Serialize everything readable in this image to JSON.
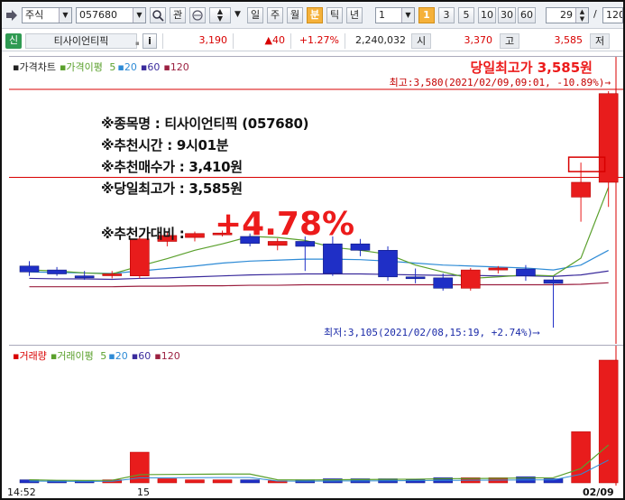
{
  "toolbar": {
    "market": "주식",
    "code": "057680",
    "btn_gwan": "관",
    "period_ticks": [
      "일",
      "주",
      "월",
      "분",
      "틱",
      "년"
    ],
    "active_period": "분",
    "interval_value": "1",
    "interval_buttons": [
      "1",
      "3",
      "5",
      "10",
      "30",
      "60"
    ],
    "active_interval": "1",
    "count_value": "29",
    "slash": "/",
    "total_value": "120"
  },
  "quote": {
    "tag": "신",
    "name": "티사이언티픽",
    "info_btn": "i",
    "price": "3,190",
    "change": "▲40",
    "rate": "+1.27%",
    "volume": "2,240,032",
    "open_label": "시",
    "open_value": "3,370",
    "high_label": "고",
    "high_value": "3,585",
    "low_label": "저"
  },
  "price_legend": {
    "main": "가격차트",
    "ma_title": "가격이평",
    "ma": [
      "5",
      "20",
      "60",
      "120"
    ]
  },
  "volume_legend": {
    "main": "거래량",
    "ma_title": "거래이평",
    "ma": [
      "5",
      "20",
      "60",
      "120"
    ]
  },
  "notes": {
    "line1": "※종목명 : 티사이언티픽 (057680)",
    "line2": "※추천시간 : 9시01분",
    "line3": "※추천매수가 : 3,410원",
    "line4": "※당일최고가 : 3,585원",
    "line5_label": "※추천가대비 :",
    "line5_value": "+4.78%"
  },
  "max_annotation": {
    "headline": "당일최고가 3,585원",
    "sub": "최고:3,580(2021/02/09,09:01, -10.89%)→"
  },
  "min_annotation": "최저:3,105(2021/02/08,15:19, +2.74%)⟶",
  "xaxis": [
    "14:52",
    "15",
    "02/09"
  ],
  "colors": {
    "up": "#e81c1c",
    "down": "#1f2fc6",
    "ma5": "#5aa02c",
    "ma20": "#2e8bd6",
    "ma60": "#3a2b9c",
    "ma120": "#9b2040"
  },
  "chart_data": {
    "type": "candlestick",
    "candles": [
      {
        "o": 3230,
        "h": 3240,
        "l": 3210,
        "c": 3218
      },
      {
        "o": 3222,
        "h": 3228,
        "l": 3210,
        "c": 3214
      },
      {
        "o": 3210,
        "h": 3220,
        "l": 3202,
        "c": 3206
      },
      {
        "o": 3212,
        "h": 3220,
        "l": 3205,
        "c": 3214
      },
      {
        "o": 3210,
        "h": 3290,
        "l": 3205,
        "c": 3285
      },
      {
        "o": 3280,
        "h": 3300,
        "l": 3270,
        "c": 3292
      },
      {
        "o": 3288,
        "h": 3300,
        "l": 3280,
        "c": 3296
      },
      {
        "o": 3296,
        "h": 3302,
        "l": 3290,
        "c": 3297
      },
      {
        "o": 3290,
        "h": 3296,
        "l": 3270,
        "c": 3276
      },
      {
        "o": 3272,
        "h": 3286,
        "l": 3262,
        "c": 3280
      },
      {
        "o": 3280,
        "h": 3290,
        "l": 3220,
        "c": 3270
      },
      {
        "o": 3275,
        "h": 3290,
        "l": 3210,
        "c": 3215
      },
      {
        "o": 3275,
        "h": 3285,
        "l": 3250,
        "c": 3262
      },
      {
        "o": 3262,
        "h": 3270,
        "l": 3200,
        "c": 3208
      },
      {
        "o": 3208,
        "h": 3225,
        "l": 3195,
        "c": 3206
      },
      {
        "o": 3206,
        "h": 3215,
        "l": 3180,
        "c": 3185
      },
      {
        "o": 3185,
        "h": 3226,
        "l": 3180,
        "c": 3222
      },
      {
        "o": 3222,
        "h": 3230,
        "l": 3215,
        "c": 3226
      },
      {
        "o": 3224,
        "h": 3232,
        "l": 3200,
        "c": 3210
      },
      {
        "o": 3202,
        "h": 3208,
        "l": 3105,
        "c": 3195
      },
      {
        "o": 3370,
        "h": 3440,
        "l": 3320,
        "c": 3400
      },
      {
        "o": 3400,
        "h": 3585,
        "l": 3350,
        "c": 3580
      }
    ],
    "price_min": 3105,
    "price_max": 3585,
    "volumes": [
      3,
      2,
      2,
      3,
      30,
      4,
      3,
      3,
      3,
      2,
      3,
      4,
      4,
      4,
      3,
      5,
      5,
      5,
      6,
      4,
      50,
      120
    ],
    "ma5": [
      3222,
      3220,
      3216,
      3214,
      3230,
      3245,
      3262,
      3275,
      3290,
      3288,
      3282,
      3268,
      3262,
      3254,
      3232,
      3218,
      3205,
      3208,
      3212,
      3210,
      3246,
      3390
    ],
    "ma20": [
      3218,
      3217,
      3216,
      3215,
      3220,
      3225,
      3230,
      3236,
      3240,
      3242,
      3244,
      3244,
      3243,
      3240,
      3236,
      3232,
      3230,
      3228,
      3226,
      3222,
      3232,
      3262
    ],
    "ma60": [
      3205,
      3204,
      3204,
      3203,
      3205,
      3206,
      3208,
      3210,
      3212,
      3213,
      3214,
      3214,
      3214,
      3213,
      3212,
      3211,
      3211,
      3210,
      3210,
      3209,
      3212,
      3220
    ],
    "ma120": [
      3188,
      3188,
      3188,
      3188,
      3189,
      3189,
      3190,
      3190,
      3191,
      3191,
      3192,
      3192,
      3192,
      3192,
      3192,
      3192,
      3192,
      3192,
      3192,
      3192,
      3193,
      3196
    ]
  }
}
